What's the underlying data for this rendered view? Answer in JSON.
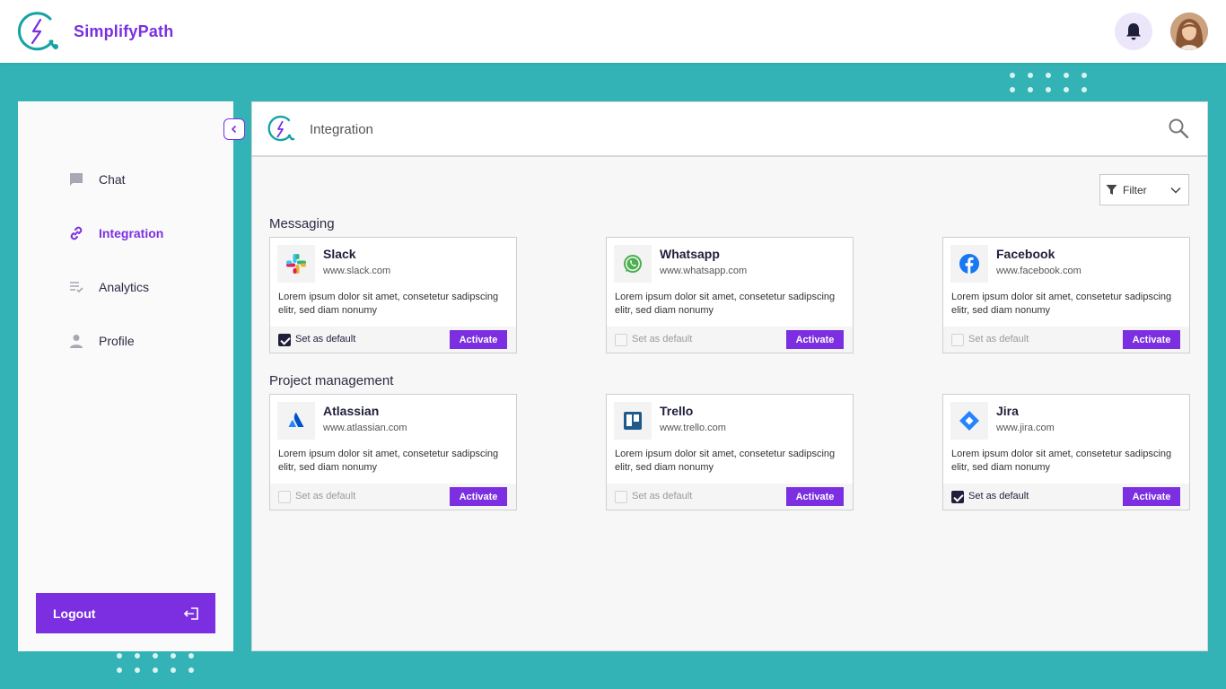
{
  "app": {
    "name": "SimplifyPath"
  },
  "colors": {
    "accent": "#7b2fe0",
    "teal": "#33b3b5"
  },
  "header": {
    "notification_icon": "bell-icon",
    "avatar": "user-avatar"
  },
  "sidebar": {
    "items": [
      {
        "label": "Chat",
        "icon": "chat-icon",
        "active": false
      },
      {
        "label": "Integration",
        "icon": "link-icon",
        "active": true
      },
      {
        "label": "Analytics",
        "icon": "analytics-icon",
        "active": false
      },
      {
        "label": "Profile",
        "icon": "profile-icon",
        "active": false
      }
    ],
    "logout_label": "Logout"
  },
  "main": {
    "title": "Integration",
    "filter_label": "Filter",
    "sections": [
      {
        "title": "Messaging",
        "cards": [
          {
            "name": "Slack",
            "url": "www.slack.com",
            "desc": "Lorem ipsum dolor sit amet, consetetur sadipscing elitr, sed diam nonumy",
            "default_label": "Set as default",
            "is_default": true,
            "activate_label": "Activate",
            "icon": "slack-icon"
          },
          {
            "name": "Whatsapp",
            "url": "www.whatsapp.com",
            "desc": "Lorem ipsum dolor sit amet, consetetur sadipscing elitr, sed diam nonumy",
            "default_label": "Set as default",
            "is_default": false,
            "activate_label": "Activate",
            "icon": "whatsapp-icon"
          },
          {
            "name": "Facebook",
            "url": "www.facebook.com",
            "desc": "Lorem ipsum dolor sit amet, consetetur sadipscing elitr, sed diam nonumy",
            "default_label": "Set as default",
            "is_default": false,
            "activate_label": "Activate",
            "icon": "facebook-icon"
          }
        ]
      },
      {
        "title": "Project management",
        "cards": [
          {
            "name": "Atlassian",
            "url": "www.atlassian.com",
            "desc": "Lorem ipsum dolor sit amet, consetetur sadipscing elitr, sed diam nonumy",
            "default_label": "Set as default",
            "is_default": false,
            "activate_label": "Activate",
            "icon": "atlassian-icon"
          },
          {
            "name": "Trello",
            "url": "www.trello.com",
            "desc": "Lorem ipsum dolor sit amet, consetetur sadipscing elitr, sed diam nonumy",
            "default_label": "Set as default",
            "is_default": false,
            "activate_label": "Activate",
            "icon": "trello-icon"
          },
          {
            "name": "Jira",
            "url": "www.jira.com",
            "desc": "Lorem ipsum dolor sit amet, consetetur sadipscing elitr, sed diam nonumy",
            "default_label": "Set as default",
            "is_default": true,
            "activate_label": "Activate",
            "icon": "jira-icon"
          }
        ]
      }
    ]
  }
}
